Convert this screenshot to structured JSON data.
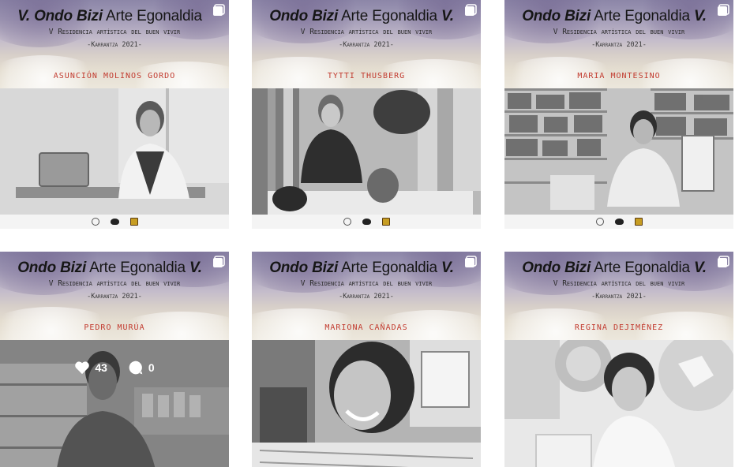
{
  "grid": {
    "posts": [
      {
        "title_italic": "V. Ondo Bizi",
        "title_plain": " Arte Egonaldia",
        "subtitle": "V Residencia artística del buen vivir",
        "place": "-Karrantza 2021-",
        "artist": "ASUNCIÓN MOLINOS GORDO",
        "has_logos": true
      },
      {
        "title_italic": "Ondo Bizi",
        "title_plain": " Arte Egonaldia ",
        "title_suffix": "V.",
        "subtitle": "V Residencia artística del buen vivir",
        "place": "-Karrantza 2021-",
        "artist": "TYTTI THUSBERG",
        "has_logos": true
      },
      {
        "title_italic": "Ondo Bizi",
        "title_plain": " Arte Egonaldia ",
        "title_suffix": "V.",
        "subtitle": "V Residencia artística del buen vivir",
        "place": "-Karrantza 2021-",
        "artist": "MARIA MONTESINO",
        "has_logos": true
      },
      {
        "title_italic": "Ondo Bizi",
        "title_plain": " Arte Egonaldia ",
        "title_suffix": "V.",
        "subtitle": "V Residencia artística del buen vivir",
        "place": "-Karrantza 2021-",
        "artist": "PEDRO MURÚA",
        "hover": {
          "likes": "43",
          "comments": "0"
        }
      },
      {
        "title_italic": "Ondo Bizi",
        "title_plain": " Arte Egonaldia ",
        "title_suffix": "V.",
        "subtitle": "V Residencia artística del buen vivir",
        "place": "-Karrantza 2021-",
        "artist": "MARIONA CAÑADAS"
      },
      {
        "title_italic": "Ondo Bizi",
        "title_plain": " Arte Egonaldia ",
        "title_suffix": "V.",
        "subtitle": "V Residencia artística del buen vivir",
        "place": "-Karrantza 2021-",
        "artist": "REGINA DEJIMÉNEZ"
      }
    ]
  },
  "icons": {
    "multi": "multiple-images-icon",
    "like": "heart-icon",
    "comment": "comment-icon"
  },
  "colors": {
    "artist_name": "#c23b2f",
    "banner_top": "#8c86a8",
    "banner_bottom": "#ece7dc"
  }
}
